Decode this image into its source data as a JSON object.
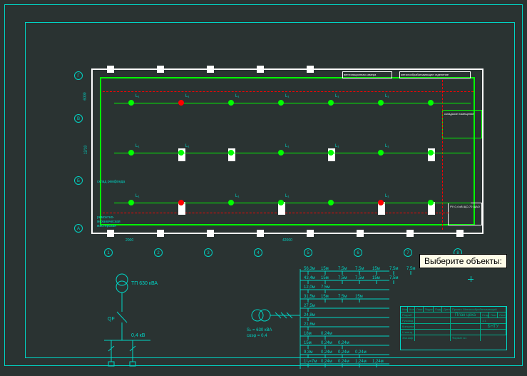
{
  "tooltip": {
    "text": "Выберите объекты:"
  },
  "grid": {
    "rows": [
      "Г",
      "В",
      "Б",
      "А"
    ],
    "cols": [
      "1",
      "2",
      "3",
      "4",
      "5",
      "6",
      "7",
      "8"
    ],
    "dim_h1": "2000",
    "dim_h2": "42000",
    "dim_v1": "6000",
    "dim_v2": "12/10"
  },
  "rooms": {
    "panel1": "вентиляционная камера",
    "panel2": "металообрабатывающее отделение",
    "panel3": "ремонтно-механическая мастерская",
    "panel4": "склад ремфонда",
    "subroom_txt": "складское помещение",
    "subroom2_txt": "РУ-0,4 кВ ЩО-70 ЩАО"
  },
  "lighting": {
    "label": "L₁"
  },
  "sld_left": {
    "tp": "ТП 630 кВА",
    "qf": "QF",
    "lv": "0,4 кВ"
  },
  "sld_right": {
    "s": "Sₙ = 630 кВА",
    "cos": "cosφ = 0,4",
    "rows": [
      "56,3м  15м  7,5м  7,5м  15м  7,5м  7,5м",
      "43,4м  15м  7,5м  7,5м  15м  7,5м",
      "12,0м  7,5м",
      "31,5м  15м  7,5м  15м",
      "27,5м",
      "24,8м",
      "21,6м",
      "18м  0,24м",
      "15м  0,24м 0,24м",
      "9,3м  0,24м 0,24м 0,24м",
      "1¹₁=7м 0,24м 0,24м 1,24м  1,24м"
    ]
  },
  "title_block": {
    "project": "Проект: Металообрабатывающий производственный цех",
    "sheet": "План цеха",
    "stage": "Стадия",
    "sheet_no": "Лист 5",
    "sheets": "Листов 5",
    "org": "БНТУ",
    "scale": "1:1",
    "format": "Формат А1",
    "cols": [
      "Изм",
      "Кол",
      "Лист",
      "№док",
      "Подп",
      "Дата"
    ],
    "roles": [
      "Разраб",
      "Руковод",
      "Консульт",
      "Н.контр",
      "Зав.каф"
    ]
  }
}
